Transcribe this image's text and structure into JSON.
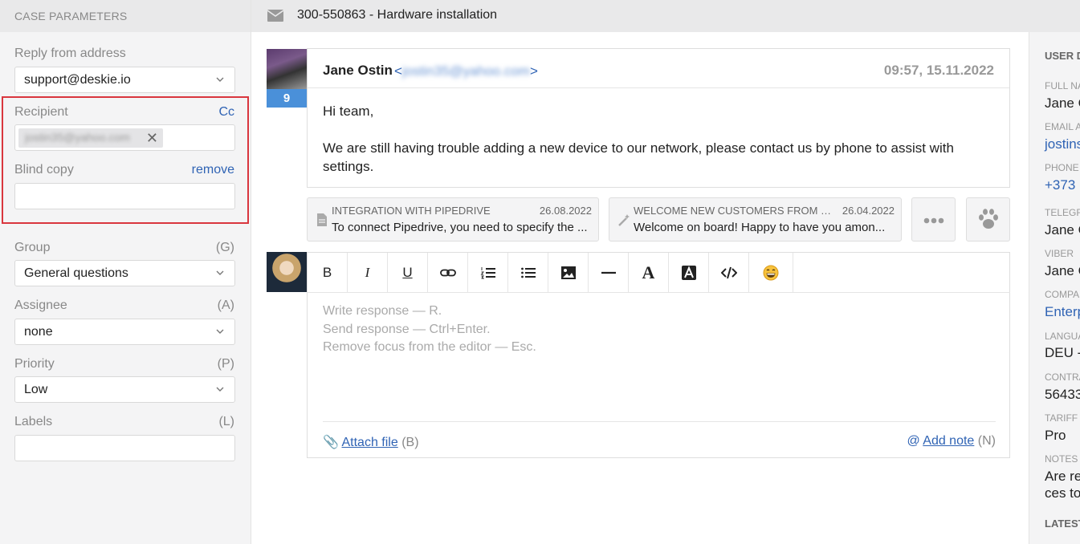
{
  "left_panel": {
    "header": "CASE PARAMETERS",
    "reply_from": {
      "label": "Reply from address",
      "value": "support@deskie.io"
    },
    "recipient": {
      "label": "Recipient",
      "cc_link": "Cc",
      "chip_value": "jostin35@yahoo.com"
    },
    "blind_copy": {
      "label": "Blind copy",
      "remove_link": "remove",
      "value": ""
    },
    "group": {
      "label": "Group",
      "shortcut": "(G)",
      "value": "General questions"
    },
    "assignee": {
      "label": "Assignee",
      "shortcut": "(A)",
      "value": "none"
    },
    "priority": {
      "label": "Priority",
      "shortcut": "(P)",
      "value": "Low"
    },
    "labels": {
      "label": "Labels",
      "shortcut": "(L)",
      "value": ""
    }
  },
  "header": {
    "case_title": "300-550863 - Hardware installation"
  },
  "message": {
    "badge": "9",
    "sender_name": "Jane Ostin",
    "sender_email": "jostin35@yahoo.com",
    "email_open": "<",
    "email_close": ">",
    "time": "09:57, 15.11.2022",
    "greeting": "Hi team,",
    "body": "We are still having trouble adding a new device to our network, please contact us by phone to assist with settings."
  },
  "templates": [
    {
      "name": "INTEGRATION WITH PIPEDRIVE",
      "date": "26.08.2022",
      "preview": "To connect Pipedrive, you need to specify the ...",
      "icon": "document-icon"
    },
    {
      "name": "WELCOME NEW CUSTOMERS FROM O...",
      "date": "26.04.2022",
      "preview": "Welcome on board! Happy to have you amon...",
      "icon": "magic-wand-icon"
    }
  ],
  "editor": {
    "toolbar": [
      "bold",
      "italic",
      "underline",
      "link",
      "numbered-list",
      "bulleted-list",
      "image",
      "horizontal-rule",
      "text-color",
      "background-color",
      "code",
      "emoji"
    ],
    "placeholder_lines": [
      "Write response — R.",
      "Send response — Ctrl+Enter.",
      "Remove focus from the editor — Esc."
    ],
    "attach_label": "Attach file",
    "attach_shortcut": "(B)",
    "note_label": "Add note",
    "note_shortcut": "(N)"
  },
  "right_panel": {
    "title": "USER D",
    "fields": [
      {
        "label": "FULL NA",
        "value": "Jane C"
      },
      {
        "label": "EMAIL A",
        "value": "jostins",
        "link": true
      },
      {
        "label": "PHONE",
        "value": "+373",
        "link": true
      },
      {
        "label": "TELEGR",
        "value": "Jane C"
      },
      {
        "label": "VIBER",
        "value": "Jane C"
      },
      {
        "label": "COMPAN",
        "value": "Enterp",
        "link": true
      },
      {
        "label": "LANGUA",
        "value": "DEU -"
      },
      {
        "label": "CONTRA",
        "value": "56433"
      },
      {
        "label": "TARIFF",
        "value": "Pro"
      },
      {
        "label": "NOTES",
        "value": "Are re",
        "value2": "ces to"
      }
    ],
    "latest": "LATEST"
  },
  "colors": {
    "accent": "#2f63b4",
    "highlight": "#d9363e",
    "badge": "#4a90d9"
  }
}
